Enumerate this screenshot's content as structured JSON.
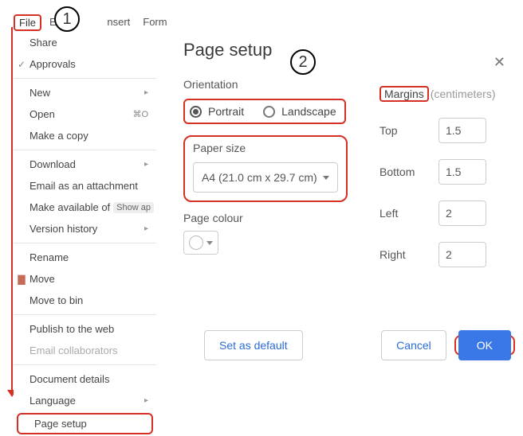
{
  "menubar": {
    "file": "File",
    "edit": "Edit",
    "insert": "nsert",
    "form": "Form"
  },
  "annotations": {
    "n1": "1",
    "n2": "2"
  },
  "filemenu": {
    "share": "Share",
    "approvals": "Approvals",
    "new": "New",
    "open": "Open",
    "open_shortcut": "⌘O",
    "make_copy": "Make a copy",
    "download": "Download",
    "email_attachment": "Email as an attachment",
    "make_available_of": "Make available of",
    "show_ap": "Show ap",
    "version_history": "Version history",
    "rename": "Rename",
    "move": "Move",
    "move_bin": "Move to bin",
    "publish": "Publish to the web",
    "email_collab": "Email collaborators",
    "doc_details": "Document details",
    "language": "Language",
    "page_setup": "Page setup"
  },
  "dialog": {
    "title": "Page setup",
    "orientation_label": "Orientation",
    "opt_portrait": "Portrait",
    "opt_landscape": "Landscape",
    "paper_label": "Paper size",
    "paper_value": "A4 (21.0 cm x 29.7 cm)",
    "colour_label": "Page colour",
    "margins_label": "Margins",
    "margins_unit": "(centimeters)",
    "m_top": "Top",
    "m_top_v": "1.5",
    "m_bottom": "Bottom",
    "m_bottom_v": "1.5",
    "m_left": "Left",
    "m_left_v": "2",
    "m_right": "Right",
    "m_right_v": "2",
    "set_default": "Set as default",
    "cancel": "Cancel",
    "ok": "OK"
  }
}
